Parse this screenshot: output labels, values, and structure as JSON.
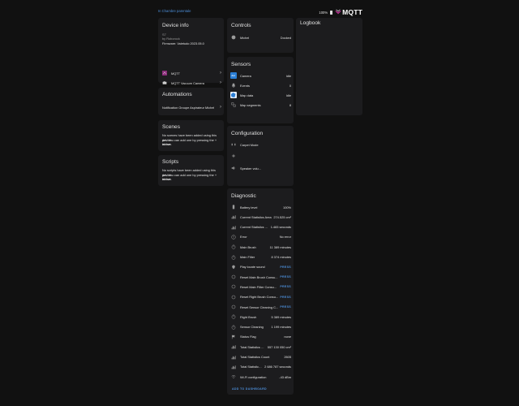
{
  "header": {
    "breadcrumb": "In Chambre parentale",
    "battery_percent": "100%",
    "logo_text": "MQTT"
  },
  "device_info": {
    "title": "Device info",
    "model": "S7",
    "manufacturer": "by Roborock",
    "firmware": "Firmware: Valetudo 2023.05.0",
    "links": [
      {
        "label": "MQTT",
        "icon": "mqtt-logo-icon"
      },
      {
        "label": "MQTT Vacuum Camera",
        "icon": "camera-logo-icon"
      }
    ]
  },
  "automations": {
    "title": "Automations",
    "items": [
      {
        "label": "Notification Groupe Aspirateur Michel"
      }
    ]
  },
  "scenes": {
    "title": "Scenes",
    "empty_text_1": "No scenes have been added using this device",
    "empty_text_2": "yet. You can add one by pressing the + button",
    "empty_text_3": "above."
  },
  "scripts": {
    "title": "Scripts",
    "empty_text_1": "No scripts have been added using this device",
    "empty_text_2": "yet. You can add one by pressing the + button",
    "empty_text_3": "above."
  },
  "controls": {
    "title": "Controls",
    "items": [
      {
        "label": "Michel",
        "value": "Docked",
        "icon": "robot-vacuum-icon"
      }
    ]
  },
  "sensors": {
    "title": "Sensors",
    "items": [
      {
        "label": "Camera",
        "value": "Idle",
        "icon": "camera-thumbnail-icon"
      },
      {
        "label": "Events",
        "value": "0",
        "icon": "bell-icon"
      },
      {
        "label": "Map data",
        "value": "Idle",
        "icon": "map-thumbnail-icon"
      },
      {
        "label": "Map segments",
        "value": "8",
        "icon": "segments-icon"
      }
    ]
  },
  "configuration": {
    "title": "Configuration",
    "items": [
      {
        "label": "Carpet Mode",
        "icon": "carpet-icon"
      },
      {
        "label": "",
        "icon": "fan-icon"
      },
      {
        "label": "Speaker volu...",
        "icon": "speaker-icon"
      }
    ]
  },
  "diagnostic": {
    "title": "Diagnostic",
    "items": [
      {
        "label": "Battery level",
        "value": "100%",
        "icon": "battery-icon"
      },
      {
        "label": "Current Statistics Area",
        "value": "274.525 cm²",
        "icon": "chart-icon"
      },
      {
        "label": "Current Statistics Ti...",
        "value": "1.483 seconds",
        "icon": "chart-icon"
      },
      {
        "label": "Error",
        "value": "No error",
        "icon": "alert-icon"
      },
      {
        "label": "Main Brush",
        "value": "11 389 minutes",
        "icon": "timer-icon"
      },
      {
        "label": "Main Filter",
        "value": "8 374 minutes",
        "icon": "timer-icon"
      },
      {
        "label": "Play locate sound",
        "value": "PRESS",
        "icon": "location-icon"
      },
      {
        "label": "Reset Main Brush Consu...",
        "value": "PRESS",
        "icon": "reset-icon"
      },
      {
        "label": "Reset Main Filter Consu...",
        "value": "PRESS",
        "icon": "reset-icon"
      },
      {
        "label": "Reset Right Brush Consu...",
        "value": "PRESS",
        "icon": "reset-icon"
      },
      {
        "label": "Reset Sensor Cleaning C...",
        "value": "PRESS",
        "icon": "reset-icon"
      },
      {
        "label": "Right Brush",
        "value": "5 389 minutes",
        "icon": "timer-icon"
      },
      {
        "label": "Sensor Cleaning",
        "value": "1 199 minutes",
        "icon": "timer-icon"
      },
      {
        "label": "Status Flag",
        "value": "none",
        "icon": "flag-icon"
      },
      {
        "label": "Total Statistics Ar...",
        "value": "557 130 050 cm²",
        "icon": "chart-icon"
      },
      {
        "label": "Total Statistics Count",
        "value": "2605",
        "icon": "chart-icon"
      },
      {
        "label": "Total Statistics ...",
        "value": "2 686 787 seconds",
        "icon": "chart-icon"
      },
      {
        "label": "Wi-Fi configuration",
        "value": "-43 dBm",
        "icon": "wifi-icon"
      }
    ],
    "add_label": "ADD TO DASHBOARD"
  },
  "logbook": {
    "title": "Logbook"
  },
  "colors": {
    "background": "#111111",
    "card": "#1c1c1e",
    "accent": "#4c8ed9",
    "text": "#e1e1e1"
  }
}
